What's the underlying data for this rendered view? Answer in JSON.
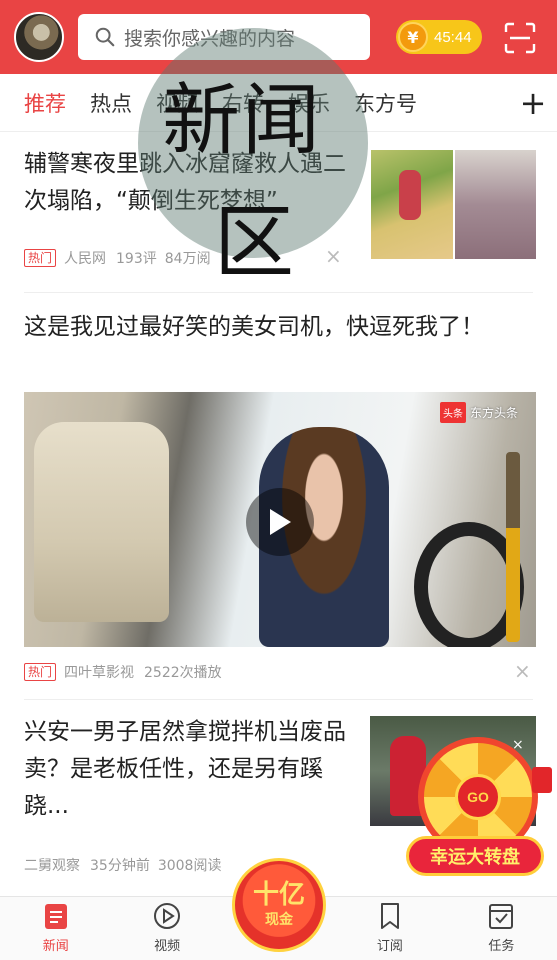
{
  "header": {
    "search_placeholder": "搜索你感兴趣的内容",
    "coin_symbol": "¥",
    "coin_value": "45:44",
    "icons": [
      "avatar",
      "search-icon",
      "coin-icon",
      "scan-icon"
    ]
  },
  "tabs": [
    {
      "label": "推荐",
      "active": true
    },
    {
      "label": "热点"
    },
    {
      "label": "视频"
    },
    {
      "label": "右转"
    },
    {
      "label": "娱乐"
    },
    {
      "label": "东方号"
    }
  ],
  "tab_add": "+",
  "articles": [
    {
      "title": "辅警寒夜里跳入冰窟窿救人遇二次塌陷，“颠倒生死梦想”",
      "tag": "热门",
      "source": "人民网",
      "stat1": "193评",
      "stat2": "84万阅"
    },
    {
      "title": "这是我见过最好笑的美女司机，快逗死我了！",
      "tag": "热门",
      "source": "四叶草影视",
      "stat1": "2522次播放",
      "video_badge_logo": "头条",
      "video_badge_brand": "东方头条"
    },
    {
      "title": "兴安一男子居然拿搅拌机当废品卖？是老板任性，还是另有蹊跷...",
      "source": "二舅观察",
      "stat1": "35分钟前",
      "stat2": "3008阅读"
    }
  ],
  "close_symbol": "×",
  "lucky_wheel": {
    "go": "GO",
    "label": "幸运大转盘",
    "close": "×"
  },
  "bottom_nav": [
    {
      "label": "新闻",
      "active": true,
      "icon": "news-icon"
    },
    {
      "label": "视频",
      "icon": "video-play-icon"
    },
    {
      "label": "",
      "icon": "promo"
    },
    {
      "label": "订阅",
      "icon": "bookmark-icon"
    },
    {
      "label": "任务",
      "icon": "task-checklist-icon"
    }
  ],
  "center_promo": {
    "big": "十亿",
    "small": "现金"
  },
  "watermark": {
    "line1": "新闻",
    "line2": "区"
  },
  "colors": {
    "brand_red": "#e94444",
    "coin_yellow": "#f7c619"
  }
}
